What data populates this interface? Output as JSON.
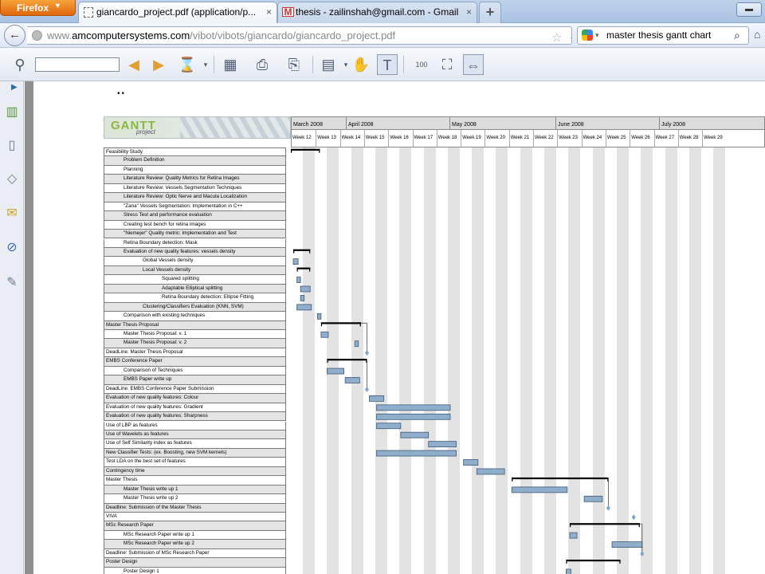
{
  "browser": {
    "menu_button": "Firefox",
    "tabs": [
      {
        "title": "giancardo_project.pdf (application/p...",
        "close": "×"
      },
      {
        "title": "thesis - zailinshah@gmail.com - Gmail",
        "close": "×"
      }
    ],
    "new_tab": "+",
    "url_prefix": "www.",
    "url_domain": "amcomputersystems.com",
    "url_path": "/vibot/vibots/giancardo/giancardo_project.pdf",
    "search_text": "master thesis gantt chart"
  },
  "icons": {
    "back": "back-arrow-icon",
    "star": "bookmark-star-icon",
    "reload": "reload-icon",
    "search": "search-icon",
    "home": "home-icon"
  },
  "pdf_toolbar": {
    "find_value": ""
  },
  "document": {
    "fragment": "..",
    "logo_main": "GANTT",
    "logo_sub": "project",
    "months": [
      "March 2008",
      "April 2008",
      "May 2008",
      "June 2008",
      "July 2008"
    ],
    "weeks": [
      "Week 12",
      "Week 13",
      "Week 14",
      "Week 15",
      "Week 16",
      "Week 17",
      "Week 18",
      "Week 19",
      "Week 20",
      "Week 21",
      "Week 22",
      "Week 23",
      "Week 24",
      "Week 25",
      "Week 26",
      "Week 27",
      "Week 28",
      "Week 29"
    ],
    "tasks": [
      {
        "name": "Feasibility Study",
        "indent": 0,
        "summary": [
          0.0,
          1.2
        ]
      },
      {
        "name": "Problem Definition",
        "indent": 1
      },
      {
        "name": "Planning",
        "indent": 1
      },
      {
        "name": "Literature Review: Quality Metrics for Retina Images",
        "indent": 1
      },
      {
        "name": "Literature Review: Vessels Segmentation Techniques",
        "indent": 1
      },
      {
        "name": "Literature Review: Optic Nerve and Macula Localization",
        "indent": 1
      },
      {
        "name": "\"Zana\" Vessels Segmentation: Implementation in C++",
        "indent": 1
      },
      {
        "name": "Stress Test and performance evaluation",
        "indent": 1
      },
      {
        "name": "Creating test bench for retina images",
        "indent": 1
      },
      {
        "name": "\"Niemejer\" Quality metric: Implementation and Test",
        "indent": 1
      },
      {
        "name": "Retina Boundary detection: Mask",
        "indent": 1
      },
      {
        "name": "Evaluation of new quality features: vessels density",
        "indent": 1,
        "summary": [
          0.1,
          0.8
        ]
      },
      {
        "name": "Global Vessels density",
        "indent": 2,
        "bar": [
          0.1,
          0.3
        ]
      },
      {
        "name": "Local Vessels density",
        "indent": 2,
        "summary": [
          0.25,
          0.8
        ]
      },
      {
        "name": "Squared splitting",
        "indent": 3,
        "bar": [
          0.25,
          0.4
        ]
      },
      {
        "name": "Adaptable Elliptical splitting",
        "indent": 3,
        "bar": [
          0.4,
          0.8
        ]
      },
      {
        "name": "Retina Boundary detection: Ellipse Fitting",
        "indent": 3,
        "bar": [
          0.4,
          0.55
        ]
      },
      {
        "name": "Clustering/Classifiers Evaluation (KNN, SVM)",
        "indent": 2,
        "bar": [
          0.25,
          0.85
        ]
      },
      {
        "name": "Comparison with existing techniques",
        "indent": 1,
        "bar": [
          1.1,
          1.25
        ]
      },
      {
        "name": "Master Thesis Proposal",
        "indent": 0,
        "summary": [
          1.25,
          2.9
        ]
      },
      {
        "name": "Master Thesis Proposal: v. 1",
        "indent": 1,
        "bar": [
          1.25,
          1.55
        ]
      },
      {
        "name": "Master Thesis Proposal: v. 2",
        "indent": 1,
        "bar": [
          2.65,
          2.8
        ]
      },
      {
        "name": "DeadLine: Master Thesis Proposal",
        "indent": 0,
        "milestone": 3.15
      },
      {
        "name": "EMBS Conference Paper",
        "indent": 0,
        "summary": [
          1.5,
          3.15
        ]
      },
      {
        "name": "Comparison of Techniques",
        "indent": 1,
        "bar": [
          1.5,
          2.2
        ]
      },
      {
        "name": "EMBS Paper write up",
        "indent": 1,
        "bar": [
          2.25,
          2.85
        ]
      },
      {
        "name": "DeadLine: EMBS Conference Paper Submission",
        "indent": 0,
        "milestone": 3.15
      },
      {
        "name": "Evaluation of new quality features: Colour",
        "indent": 0,
        "bar": [
          3.25,
          3.85
        ]
      },
      {
        "name": "Evaluation of new quality features: Gradient",
        "indent": 0,
        "bar": [
          3.55,
          6.6
        ]
      },
      {
        "name": "Evaluation of new quality features: Sharpness",
        "indent": 0,
        "bar": [
          3.55,
          6.6
        ]
      },
      {
        "name": "Use of LBP as features",
        "indent": 0,
        "bar": [
          3.55,
          4.55
        ]
      },
      {
        "name": "Use of Wavelets as features",
        "indent": 0,
        "bar": [
          4.55,
          5.7
        ]
      },
      {
        "name": "Use of Self Similarity index as features",
        "indent": 0,
        "bar": [
          5.7,
          6.85
        ]
      },
      {
        "name": "New Classifier Tests: (ex. Boosting, new SVM kernels)",
        "indent": 0,
        "bar": [
          3.55,
          6.85
        ]
      },
      {
        "name": "Test LDA on the best set of features",
        "indent": 0,
        "bar": [
          7.15,
          7.75
        ]
      },
      {
        "name": "Contingency time",
        "indent": 0,
        "bar": [
          7.7,
          8.85
        ]
      },
      {
        "name": "Master Thesis",
        "indent": 0,
        "summary": [
          9.15,
          13.15
        ]
      },
      {
        "name": "Master Thesis write up 1",
        "indent": 1,
        "bar": [
          9.15,
          11.45
        ]
      },
      {
        "name": "Master Thesis write up 2",
        "indent": 1,
        "bar": [
          12.15,
          12.9
        ]
      },
      {
        "name": "Deadline: Submission of the Master Thesis",
        "indent": 0,
        "milestone": 13.15
      },
      {
        "name": "VIVA",
        "indent": 0,
        "milestone": 14.2
      },
      {
        "name": "MSc Research Paper",
        "indent": 0,
        "summary": [
          11.55,
          14.45
        ]
      },
      {
        "name": "MSc Research Paper write up 1",
        "indent": 1,
        "bar": [
          11.55,
          11.85
        ]
      },
      {
        "name": "MSc Research Paper write up 2",
        "indent": 1,
        "bar": [
          13.3,
          14.55
        ]
      },
      {
        "name": "Deadline: Submission of MSc Research Paper",
        "indent": 0,
        "milestone": 14.55
      },
      {
        "name": "Poster Design",
        "indent": 0,
        "summary": [
          11.4,
          13.65
        ]
      },
      {
        "name": "Poster Design 1",
        "indent": 1,
        "bar": [
          11.4,
          11.6
        ]
      }
    ],
    "colors": {
      "bar_fill": "#8faecb",
      "bar_stroke": "#3e5a74",
      "summary": "#000000",
      "milestone": "#7aa6d0",
      "row_alt": "#e4e4e4"
    }
  }
}
